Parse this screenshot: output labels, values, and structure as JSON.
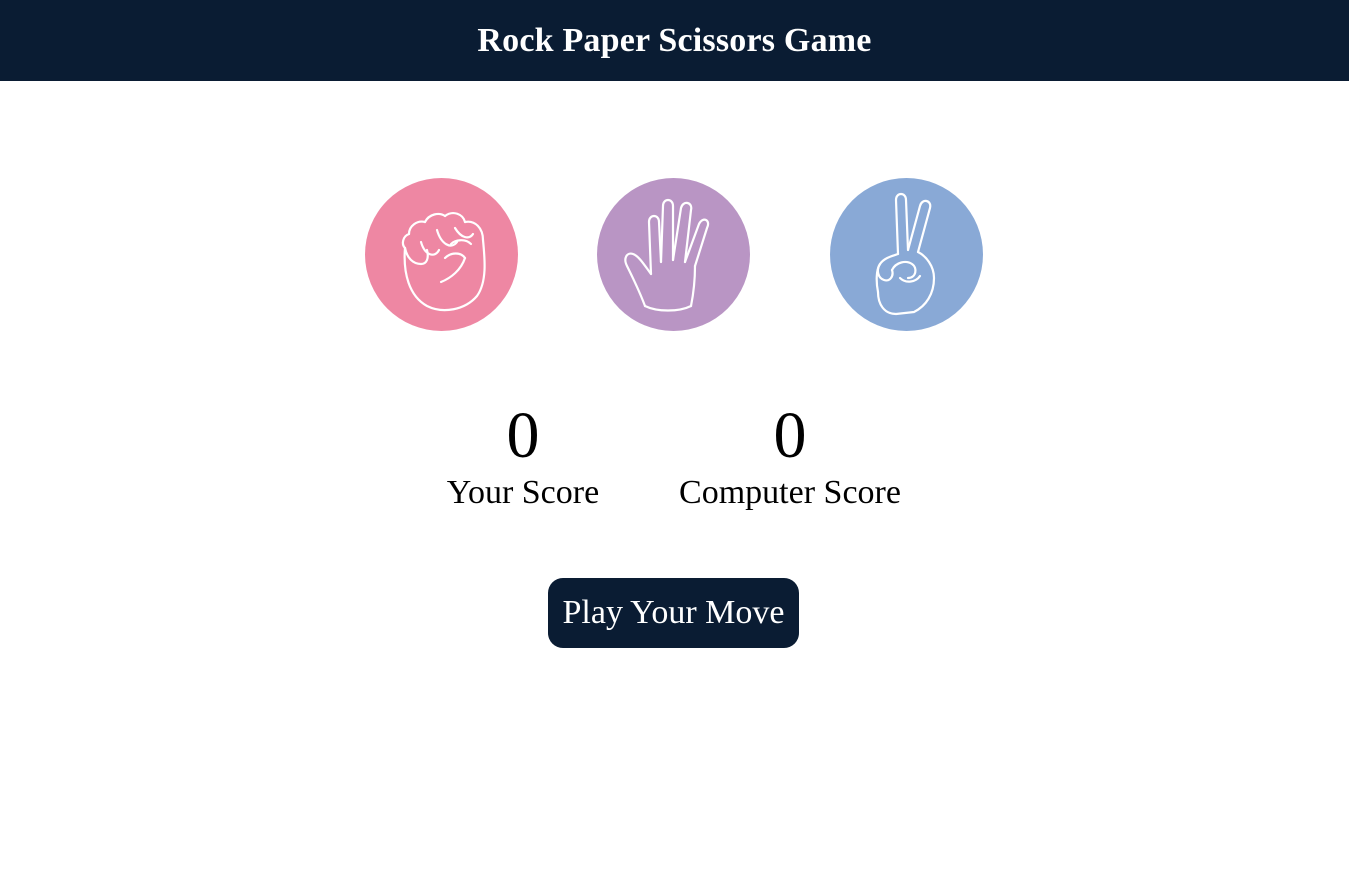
{
  "header": {
    "title": "Rock Paper Scissors Game"
  },
  "choices": [
    {
      "name": "rock",
      "icon": "fist-icon",
      "color": "#ee87a3"
    },
    {
      "name": "paper",
      "icon": "open-hand-icon",
      "color": "#b995c4"
    },
    {
      "name": "scissors",
      "icon": "peace-hand-icon",
      "color": "#89a9d6"
    }
  ],
  "scores": {
    "user": {
      "value": "0",
      "label": "Your Score"
    },
    "computer": {
      "value": "0",
      "label": "Computer Score"
    }
  },
  "message": {
    "text": "Play Your Move",
    "bg": "#0a1c33"
  },
  "colors": {
    "header_bg": "#0a1c33",
    "page_bg": "#ffffff"
  }
}
